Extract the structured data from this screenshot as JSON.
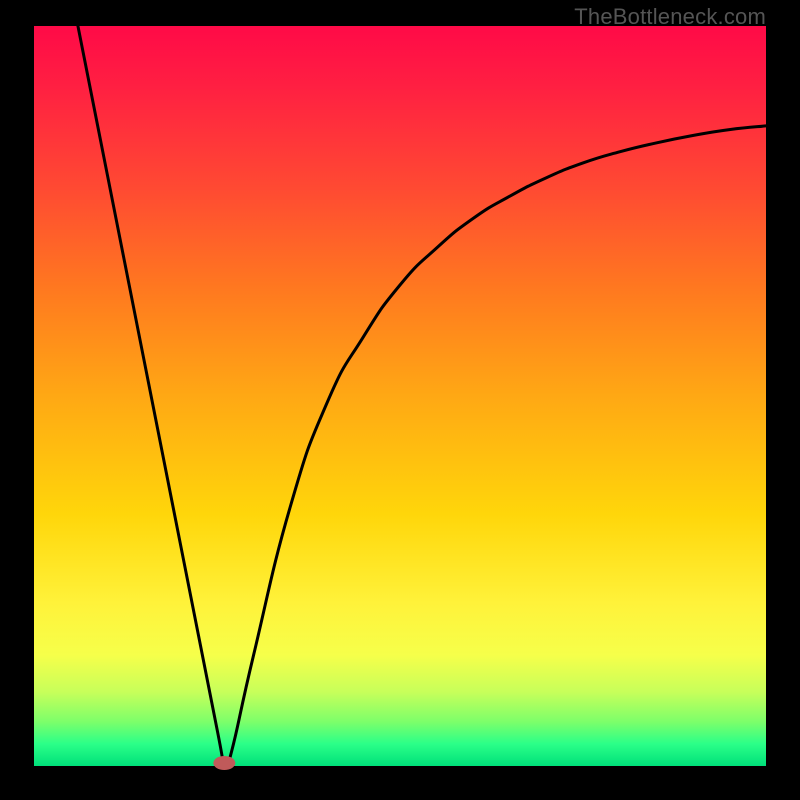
{
  "attribution": "TheBottleneck.com",
  "chart_data": {
    "type": "line",
    "title": "",
    "xlabel": "",
    "ylabel": "",
    "xlim": [
      0,
      100
    ],
    "ylim": [
      0,
      100
    ],
    "grid": false,
    "legend": false,
    "series": [
      {
        "name": "bottleneck-curve",
        "x": [
          6,
          10,
          15,
          20,
          25,
          26,
          27,
          30,
          35,
          40,
          45,
          50,
          55,
          60,
          65,
          70,
          75,
          80,
          85,
          90,
          95,
          100
        ],
        "y": [
          100,
          80,
          55,
          30,
          5,
          0,
          2,
          15,
          35,
          49,
          58,
          65,
          70,
          74,
          77,
          79.5,
          81.5,
          83,
          84.2,
          85.2,
          86,
          86.5
        ]
      }
    ],
    "marker": {
      "x": 26,
      "y": 0,
      "color": "#c05a5a"
    },
    "background_gradient": {
      "top": "#ff0a47",
      "mid_orange": "#ff7a1f",
      "mid_yellow": "#ffd60a",
      "bottom": "#00e07a"
    }
  }
}
